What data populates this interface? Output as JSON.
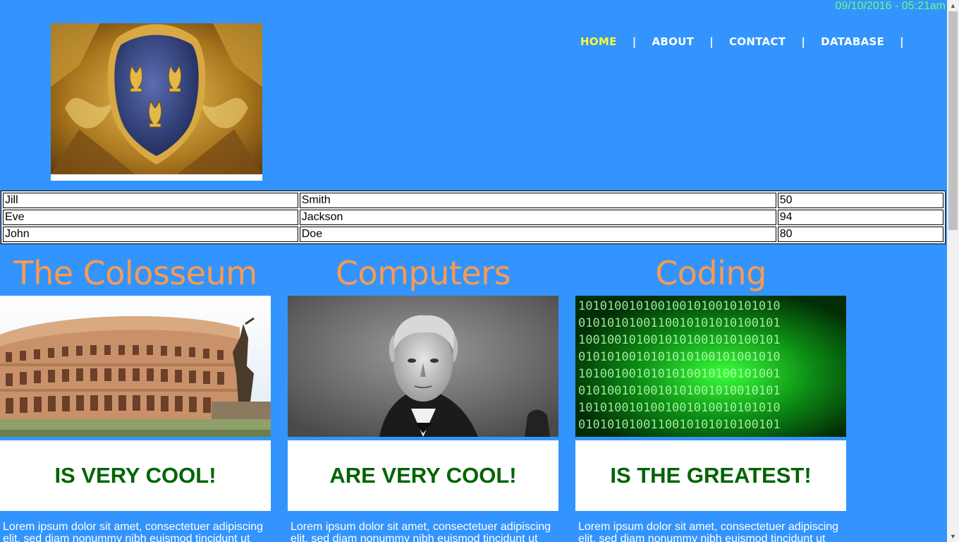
{
  "header": {
    "datetime": "09/10/2016 - 05:21am"
  },
  "nav": {
    "items": [
      {
        "label": "HOME",
        "active": true
      },
      {
        "label": "ABOUT",
        "active": false
      },
      {
        "label": "CONTACT",
        "active": false
      },
      {
        "label": "DATABASE",
        "active": false
      }
    ],
    "separator": "|"
  },
  "table": {
    "rows": [
      [
        "Jill",
        "Smith",
        "50"
      ],
      [
        "Eve",
        "Jackson",
        "94"
      ],
      [
        "John",
        "Doe",
        "80"
      ]
    ]
  },
  "cards": [
    {
      "title": "The Colosseum",
      "image": "colosseum-photo",
      "banner": "IS VERY COOL!",
      "body": "Lorem ipsum dolor sit amet, consectetuer adipiscing elit, sed diam nonummy nibh euismod tincidunt ut"
    },
    {
      "title": "Computers",
      "image": "portrait-photo",
      "banner": "ARE VERY COOL!",
      "body": "Lorem ipsum dolor sit amet, consectetuer adipiscing elit, sed diam nonummy nibh euismod tincidunt ut"
    },
    {
      "title": "Coding",
      "image": "binary-code-photo",
      "banner": "IS THE GREATEST!",
      "body": "Lorem ipsum dolor sit amet, consectetuer adipiscing elit, sed diam nonummy nibh euismod tincidunt ut"
    }
  ],
  "colors": {
    "background": "#3394fe",
    "datetime": "#6aff75",
    "nav_active": "#ffff33",
    "card_title": "#ff9a4d",
    "banner_text": "#006400"
  },
  "logo": {
    "image": "royal-crest-logo"
  }
}
